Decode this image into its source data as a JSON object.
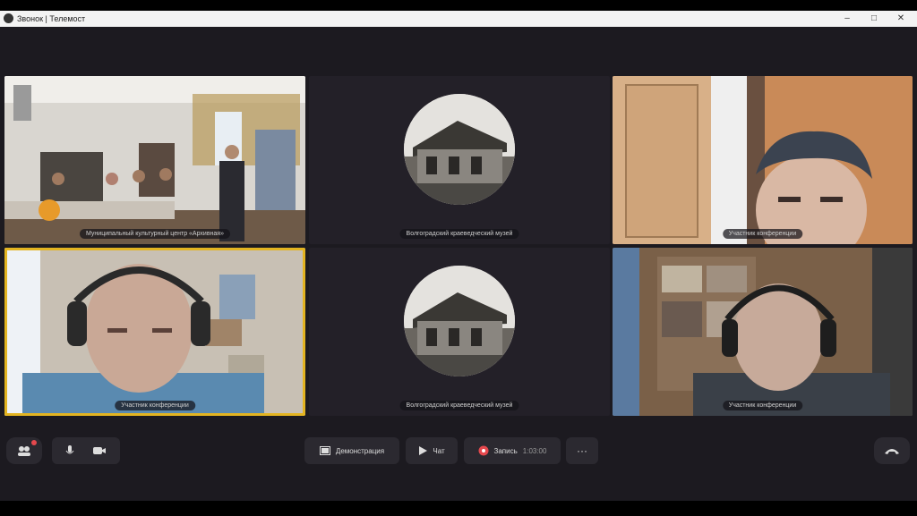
{
  "window": {
    "title": "Звонок | Телемост"
  },
  "tiles": [
    {
      "name": "Муниципальный культурный центр «Архивная»"
    },
    {
      "name": "Волгоградский краеведческий музей"
    },
    {
      "name": "Участник конференции"
    },
    {
      "name": "Участник конференции"
    },
    {
      "name": "Волгоградский краеведческий музей"
    },
    {
      "name": "Участник конференции"
    }
  ],
  "toolbar": {
    "demo_label": "Демонстрация",
    "chat_label": "Чат",
    "record_label": "Запись",
    "record_time": "1:03:00"
  },
  "colors": {
    "active_speaker": "#e3b421",
    "stage_bg": "#1c1a20",
    "tile_bg": "#232028",
    "record_dot": "#e5484d"
  }
}
